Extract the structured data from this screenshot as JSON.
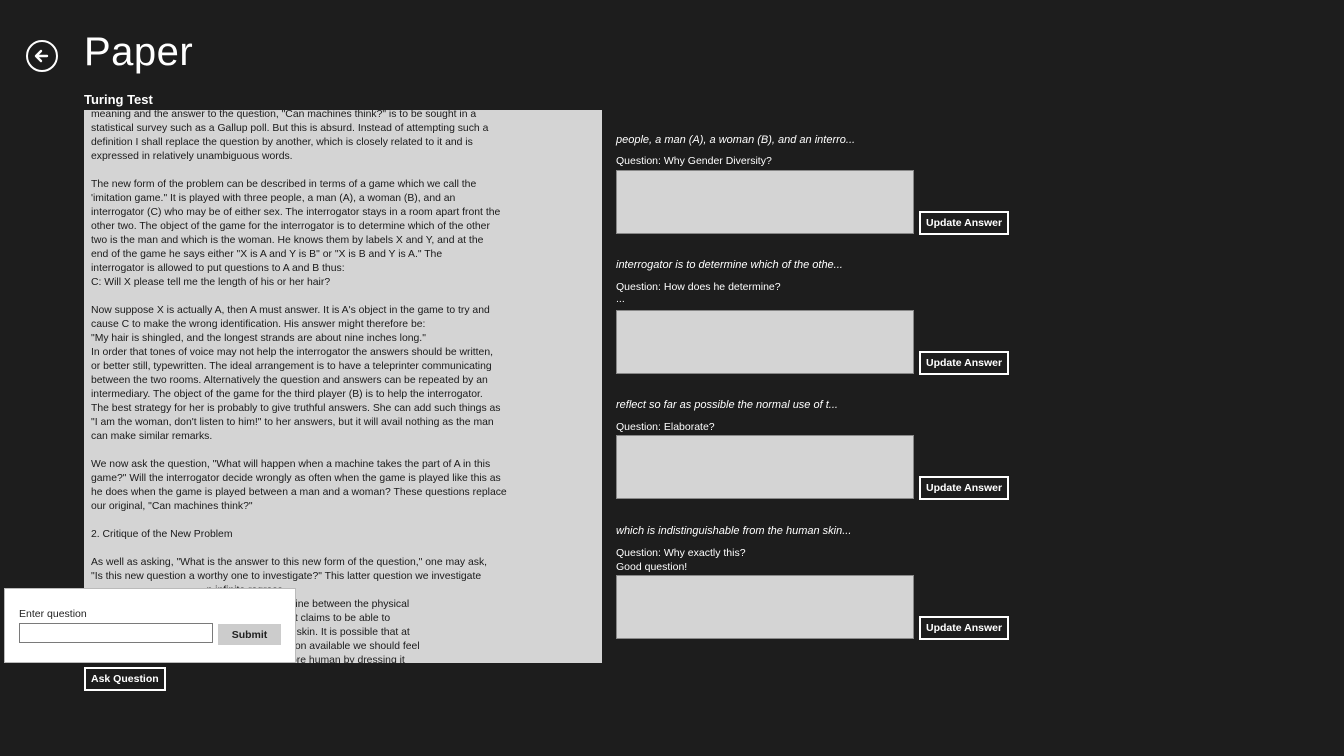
{
  "header": {
    "back_icon": "back-arrow-icon",
    "title": "Paper",
    "doc_title": "Turing Test"
  },
  "document": {
    "text": "meaning and the answer to the question, \"Can machines think?\" is to be sought in a\nstatistical survey such as a Gallup poll. But this is absurd. Instead of attempting such a\ndefinition I shall replace the question by another, which is closely related to it and is\nexpressed in relatively unambiguous words.\n\nThe new form of the problem can be described in terms of a game which we call the\n'imitation game.\" It is played with three people, a man (A), a woman (B), and an\ninterrogator (C) who may be of either sex. The interrogator stays in a room apart front the\nother two. The object of the game for the interrogator is to determine which of the other\ntwo is the man and which is the woman. He knows them by labels X and Y, and at the\nend of the game he says either \"X is A and Y is B\" or \"X is B and Y is A.\" The\ninterrogator is allowed to put questions to A and B thus:\nC: Will X please tell me the length of his or her hair?\n\nNow suppose X is actually A, then A must answer. It is A's object in the game to try and\ncause C to make the wrong identification. His answer might therefore be:\n\"My hair is shingled, and the longest strands are about nine inches long.\"\nIn order that tones of voice may not help the interrogator the answers should be written,\nor better still, typewritten. The ideal arrangement is to have a teleprinter communicating\nbetween the two rooms. Alternatively the question and answers can be repeated by an\nintermediary. The object of the game for the third player (B) is to help the interrogator.\nThe best strategy for her is probably to give truthful answers. She can add such things as\n\"I am the woman, don't listen to him!\" to her answers, but it will avail nothing as the man\ncan make similar remarks.\n\nWe now ask the question, \"What will happen when a machine takes the part of A in this\ngame?\" Will the interrogator decide wrongly as often when the game is played like this as\nhe does when the game is played between a man and a woman? These questions replace\nour original, \"Can machines think?\"\n\n2. Critique of the New Problem\n\nAs well as asking, \"What is the answer to this new form of the question,\" one may ask,\n\"Is this new question a worthy one to investigate?\" This latter question we investigate\n                                        n infinite regress.\n                                        wing a fairly sharp line between the physical\n                                        engineer or chemist claims to be able to\n                                        de from the human skin. It is possible that at\n                                        pposing this invention available we should feel\n                                        inking machine\" more human by dressing it"
  },
  "questions": [
    {
      "context": "people, a man (A), a woman (B), and an interro...",
      "question": "Question: Why Gender Diversity?",
      "answer": "",
      "button_label": "Update Answer"
    },
    {
      "context": "interrogator is to determine which of the othe...",
      "question": "Question: How does he determine?",
      "answer": "...",
      "button_label": "Update Answer"
    },
    {
      "context": "reflect so far as possible the normal use of t...",
      "question": "Question: Elaborate?",
      "answer": "",
      "button_label": "Update Answer"
    },
    {
      "context": "which is indistinguishable from the human skin...",
      "question": "Question: Why exactly this?",
      "answer": "Good question!",
      "button_label": "Update Answer"
    }
  ],
  "ask_popup": {
    "label": "Enter question",
    "input_value": "",
    "submit_label": "Submit"
  },
  "ask_button_label": "Ask Question"
}
